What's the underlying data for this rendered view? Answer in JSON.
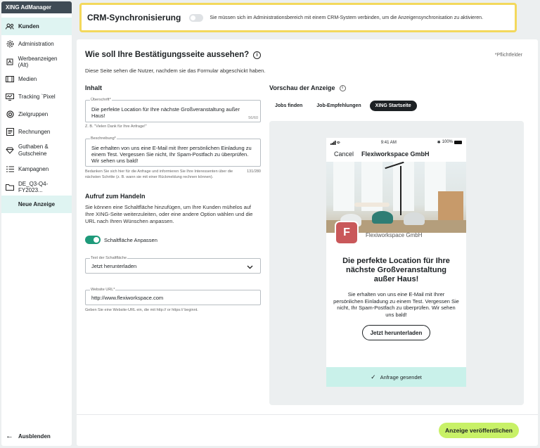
{
  "sidebar": {
    "brand": "XING AdManager",
    "items": [
      {
        "label": "Kunden"
      },
      {
        "label": "Administration"
      },
      {
        "label": "Werbeanzeigen (Alt)"
      },
      {
        "label": "Medien"
      },
      {
        "label": "Tracking `Pixel"
      },
      {
        "label": "Zielgruppen"
      },
      {
        "label": "Rechnungen"
      },
      {
        "label": "Guthaben & Gutscheine"
      },
      {
        "label": "Kampagnen"
      },
      {
        "label": "DE_Q3-Q4-FY2023..."
      },
      {
        "label": "Neue Anzeige"
      }
    ],
    "collapse_label": "Ausblenden"
  },
  "crm": {
    "title": "CRM-Synchronisierung",
    "text": "Sie müssen sich im Administrationsbereich mit einem CRM-System verbinden, um die Anzeigensynchronisation zu aktivieren."
  },
  "page": {
    "title": "Wie soll Ihre Bestätigungsseite aussehen?",
    "required_note": "*Pflichtfelder",
    "description": "Diese Seite sehen die Nutzer, nachdem sie das Formular abgeschickt haben."
  },
  "content": {
    "section_title": "Inhalt",
    "headline": {
      "label": "Überschrift*",
      "value": "Die perfekte Location für Ihre nächste Großveranstaltung außer Haus!",
      "count": "56/60",
      "hint": "Z. B. \"Vielen Dank für Ihre Anfrage!\""
    },
    "description": {
      "label": "Beschreibung*",
      "value": "Sie erhalten von uns eine E-Mail mit Ihrer persönlichen Einladung zu einem Test. Vergessen Sie nicht, Ihr Spam-Postfach zu überprüfen. Wir sehen uns bald!",
      "count": "131/280",
      "hint": "Bedanken Sie sich hier für die Anfrage und informieren Sie Ihre Interessenten über die nächsten Schritte (z. B. wann sie mit einer Rückmeldung rechnen können)."
    }
  },
  "cta": {
    "section_title": "Aufruf zum Handeln",
    "text": "Sie können eine Schaltfläche hinzufügen, um Ihre Kunden mühelos auf Ihre XING-Seite weiterzuleiten, oder eine andere Option wählen und die URL nach Ihren Wünschen anpassen.",
    "toggle_label": "Schaltfläche Anpassen",
    "button_text": {
      "label": "Text der Schaltfläche",
      "value": "Jetzt herunterladen"
    },
    "url": {
      "label": "Website URL*",
      "value": "http://www.flexiworkspace.com",
      "hint": "Geben Sie eine Website-URL ein, die mit http:// or https:// beginnt."
    }
  },
  "preview": {
    "title": "Vorschau der Anzeige",
    "tabs": [
      {
        "label": "Jobs finden"
      },
      {
        "label": "Job-Empfehlungen"
      },
      {
        "label": "XING Startseite"
      }
    ],
    "status_time": "9:41 AM",
    "status_battery": "100%",
    "cancel": "Cancel",
    "company": "Flexiworkspace GmbH",
    "logo_letter": "F",
    "headline": "Die perfekte Location für Ihre nächste Großveranstaltung außer Haus!",
    "body": "Sie erhalten von uns eine E-Mail mit Ihrer persönlichen Einladung zu einem Test. Vergessen Sie nicht, Ihr Spam-Postfach zu überprüfen. Wir sehen uns bald!",
    "button": "Jetzt herunterladen",
    "footer": "Anfrage gesendet"
  },
  "publish_label": "Anzeige veröffentlichen",
  "colors": {
    "accent_green": "#1e9a7a",
    "publish_lime": "#c8f167",
    "highlight_yellow": "#f3d85c",
    "active_mint": "#dff4f2"
  }
}
